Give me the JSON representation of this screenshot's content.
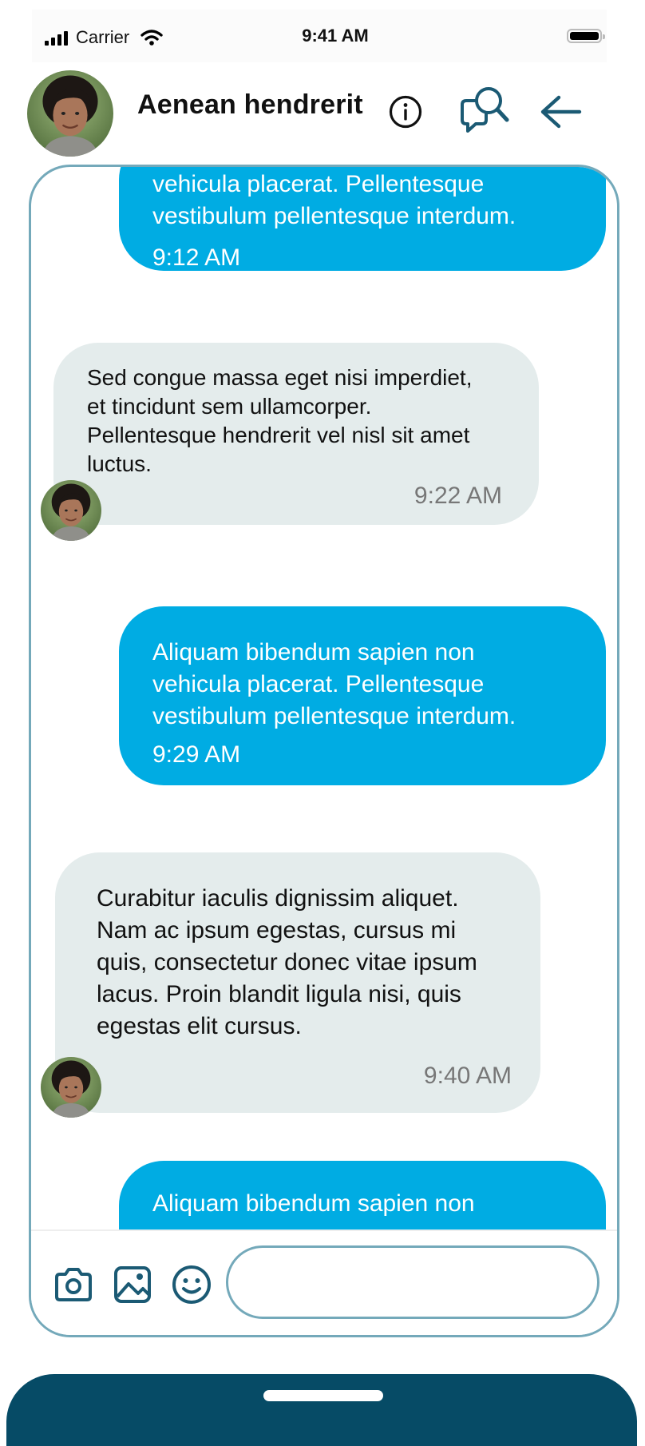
{
  "status_bar": {
    "carrier": "Carrier",
    "time": "9:41 AM"
  },
  "header": {
    "contact_name": "Aenean hendrerit",
    "icons": [
      "avatar",
      "info-icon",
      "search-chat-icon",
      "back-arrow-icon"
    ]
  },
  "messages": [
    {
      "direction": "outgoing",
      "lines": [
        "vehicula placerat. Pellentesque",
        "vestibulum pellentesque interdum."
      ],
      "time": "9:12 AM"
    },
    {
      "direction": "incoming",
      "lines": [
        "Sed congue massa eget nisi imperdiet,",
        "et tincidunt sem ullamcorper.",
        "Pellentesque hendrerit vel nisl sit amet",
        "luctus."
      ],
      "time": "9:22 AM"
    },
    {
      "direction": "outgoing",
      "lines": [
        "Aliquam bibendum sapien non",
        "vehicula placerat. Pellentesque",
        "vestibulum pellentesque interdum."
      ],
      "time": "9:29 AM"
    },
    {
      "direction": "incoming",
      "lines": [
        "Curabitur iaculis dignissim aliquet.",
        "Nam ac ipsum egestas, cursus mi",
        "quis, consectetur donec vitae ipsum",
        "lacus. Proin blandit ligula nisi, quis",
        "egestas elit cursus."
      ],
      "time": "9:40 AM"
    },
    {
      "direction": "outgoing",
      "lines": [
        "Aliquam bibendum sapien non"
      ],
      "time": ""
    }
  ],
  "composer": {
    "input_value": "",
    "input_placeholder": "",
    "icons": [
      "camera-icon",
      "image-icon",
      "emoji-icon"
    ]
  },
  "colors": {
    "outgoing_bubble": "#00ace3",
    "incoming_bubble": "#e4ecec",
    "accent": "#064b66",
    "frame_border": "#74a9ba"
  }
}
